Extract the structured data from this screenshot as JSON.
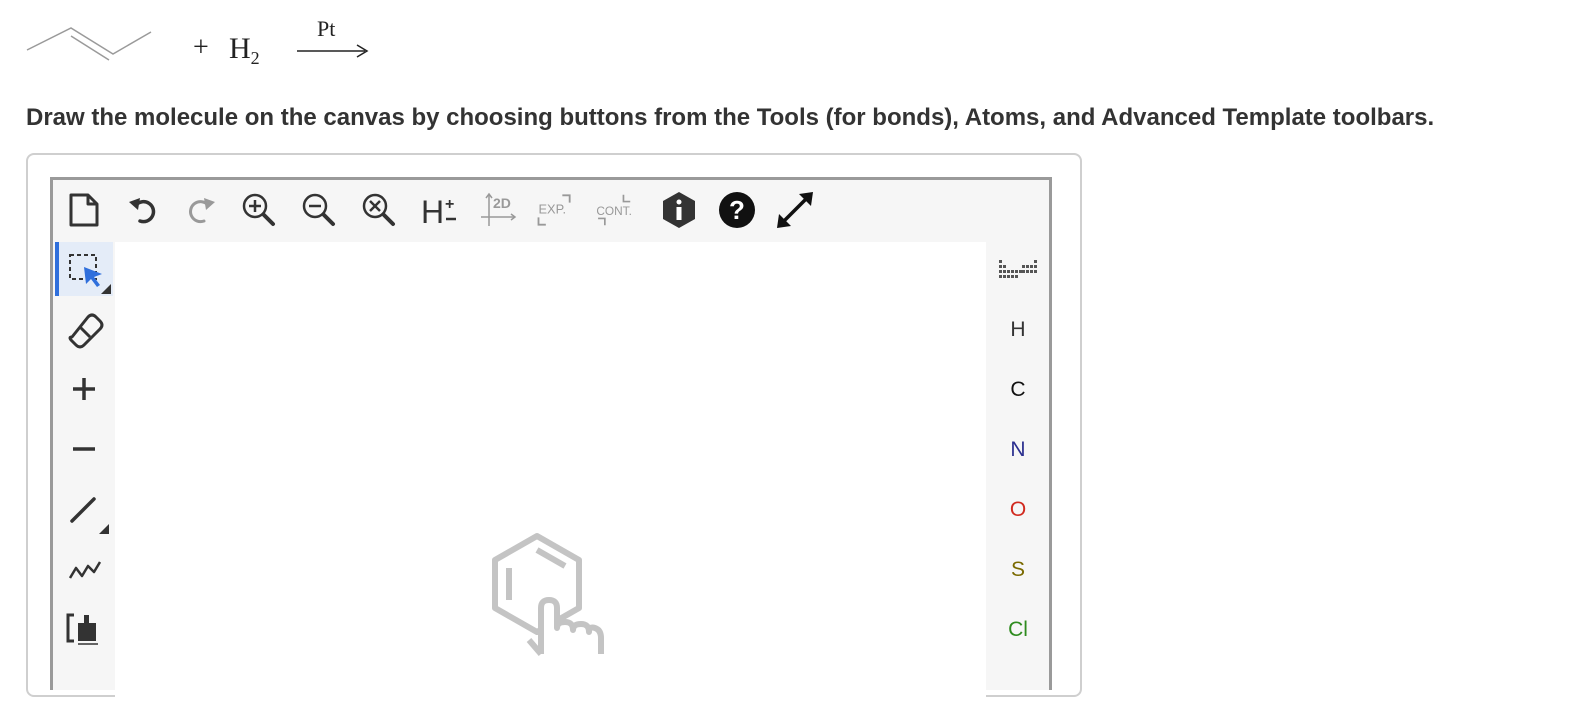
{
  "reaction": {
    "plus": "+",
    "reagent": "H",
    "reagent_subscript": "2",
    "catalyst": "Pt"
  },
  "instructions": "Draw the molecule on the canvas by choosing buttons from the Tools (for bonds), Atoms, and Advanced Template toolbars.",
  "top_toolbar": {
    "buttons": [
      {
        "name": "new-document-icon"
      },
      {
        "name": "undo-icon"
      },
      {
        "name": "redo-icon"
      },
      {
        "name": "zoom-in-icon"
      },
      {
        "name": "zoom-out-icon"
      },
      {
        "name": "zoom-reset-icon"
      },
      {
        "name": "hydrogen-toggle-icon",
        "label": "H±"
      },
      {
        "name": "clean-2d-icon",
        "label": "2D"
      },
      {
        "name": "expand-icon",
        "label": "EXP."
      },
      {
        "name": "contract-icon",
        "label": "CONT."
      },
      {
        "name": "info-icon"
      },
      {
        "name": "help-icon"
      },
      {
        "name": "fullscreen-icon"
      }
    ]
  },
  "left_toolbar": {
    "tools": [
      {
        "name": "select-tool",
        "active": true
      },
      {
        "name": "eraser-tool"
      },
      {
        "name": "charge-plus-tool",
        "label": "+"
      },
      {
        "name": "charge-minus-tool",
        "label": "−"
      },
      {
        "name": "bond-tool"
      },
      {
        "name": "chain-tool"
      },
      {
        "name": "bracket-tool"
      }
    ]
  },
  "right_toolbar": {
    "periodic_table": "periodic-table-icon",
    "atoms": [
      {
        "symbol": "H",
        "color": "#333333"
      },
      {
        "symbol": "C",
        "color": "#111111"
      },
      {
        "symbol": "N",
        "color": "#2b2f8f"
      },
      {
        "symbol": "O",
        "color": "#d12a1f"
      },
      {
        "symbol": "S",
        "color": "#7a6a00"
      },
      {
        "symbol": "Cl",
        "color": "#2e8b1e"
      }
    ]
  },
  "colors": {
    "accent": "#2f6fdc",
    "icon_gray": "#999999",
    "icon_dark": "#333333"
  }
}
